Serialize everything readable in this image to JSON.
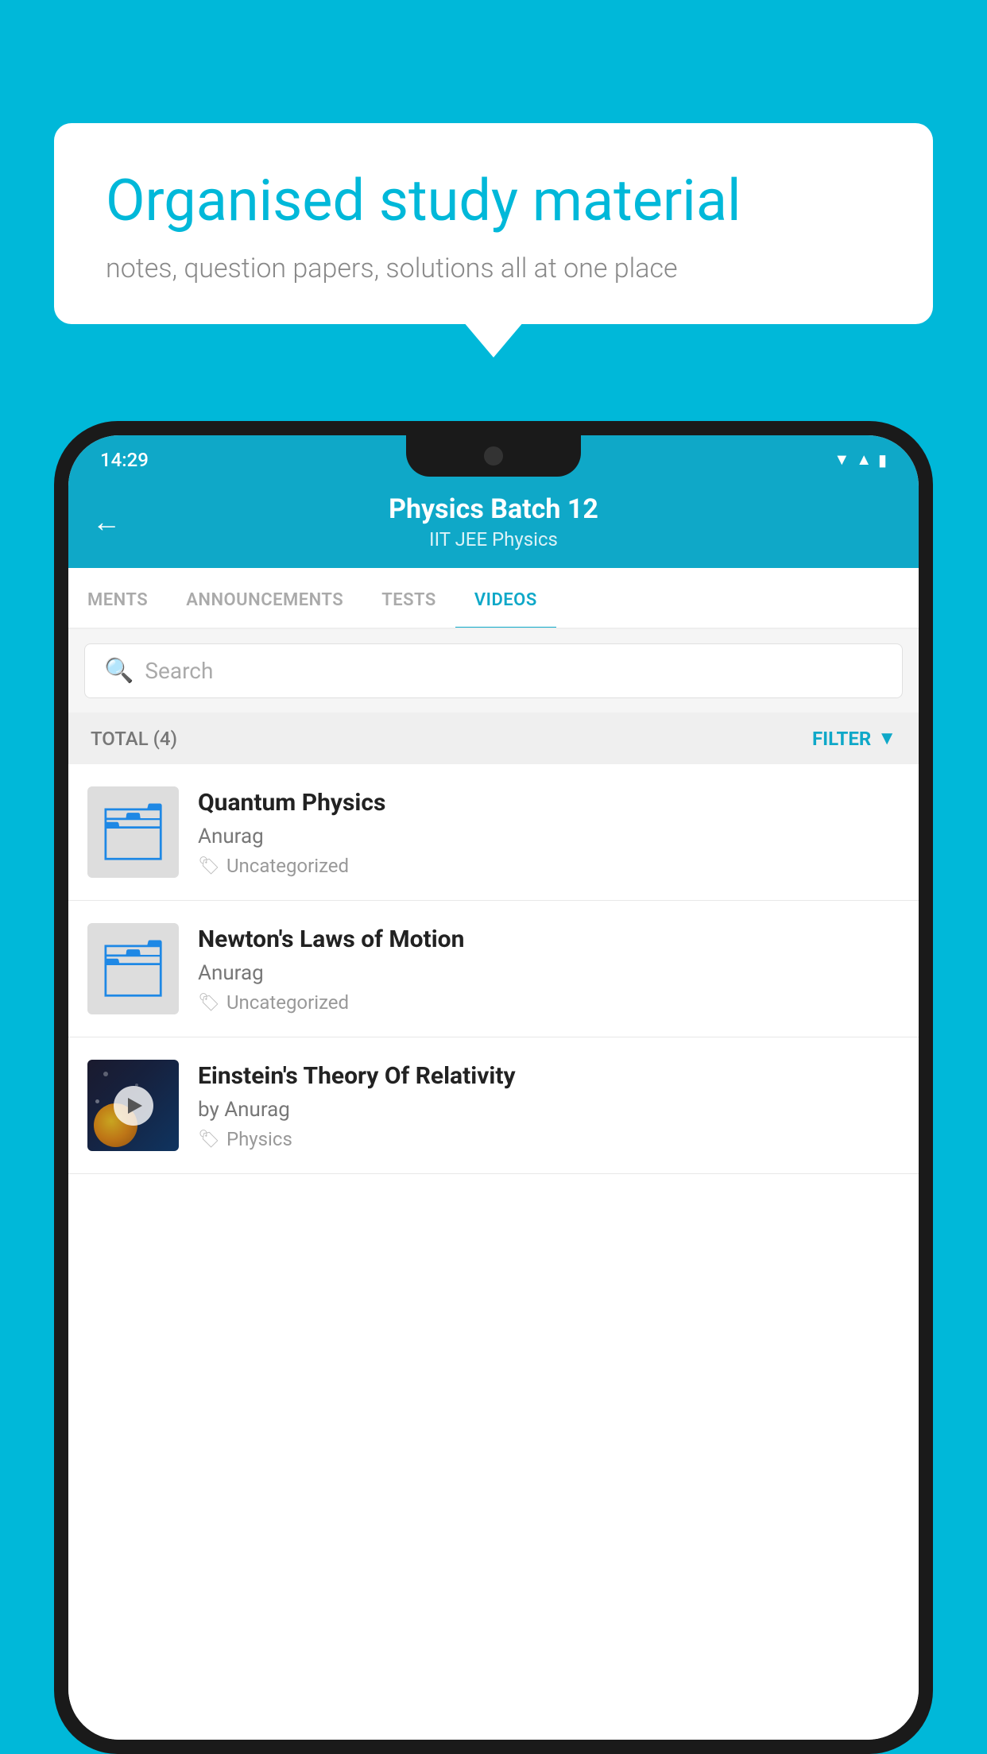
{
  "background_color": "#00b8d9",
  "speech_bubble": {
    "heading": "Organised study material",
    "subtext": "notes, question papers, solutions all at one place"
  },
  "status_bar": {
    "time": "14:29",
    "icons": [
      "wifi",
      "signal",
      "battery"
    ]
  },
  "app_header": {
    "back_label": "←",
    "title": "Physics Batch 12",
    "subtitle": "IIT JEE   Physics"
  },
  "tabs": [
    {
      "label": "MENTS",
      "active": false
    },
    {
      "label": "ANNOUNCEMENTS",
      "active": false
    },
    {
      "label": "TESTS",
      "active": false
    },
    {
      "label": "VIDEOS",
      "active": true
    }
  ],
  "search": {
    "placeholder": "Search"
  },
  "filter_bar": {
    "total_label": "TOTAL (4)",
    "filter_label": "FILTER"
  },
  "videos": [
    {
      "id": 1,
      "title": "Quantum Physics",
      "author": "Anurag",
      "tag": "Uncategorized",
      "type": "folder"
    },
    {
      "id": 2,
      "title": "Newton's Laws of Motion",
      "author": "Anurag",
      "tag": "Uncategorized",
      "type": "folder"
    },
    {
      "id": 3,
      "title": "Einstein's Theory Of Relativity",
      "author": "by Anurag",
      "tag": "Physics",
      "type": "video"
    }
  ]
}
